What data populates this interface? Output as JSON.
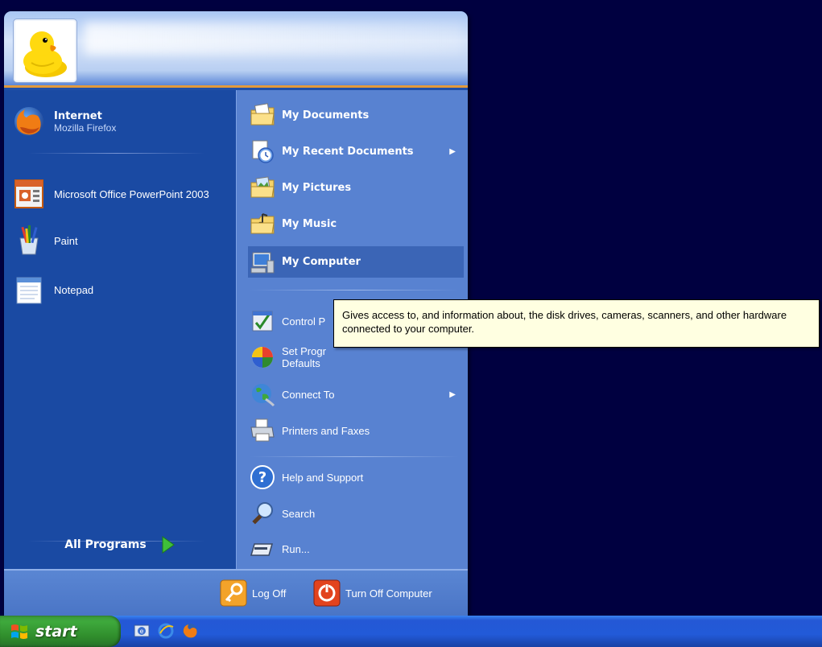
{
  "left": {
    "items": [
      {
        "label": "Internet",
        "sub": "Mozilla Firefox",
        "icon": "firefox-icon"
      },
      {
        "label": "Microsoft Office PowerPoint 2003",
        "icon": "powerpoint-icon"
      },
      {
        "label": "Paint",
        "icon": "paint-icon"
      },
      {
        "label": "Notepad",
        "icon": "notepad-icon"
      }
    ],
    "all_programs_label": "All Programs"
  },
  "right": {
    "items": [
      {
        "label": "My Documents",
        "icon": "folder-documents-icon"
      },
      {
        "label": "My Recent Documents",
        "icon": "recent-documents-icon"
      },
      {
        "label": "My Pictures",
        "icon": "folder-pictures-icon"
      },
      {
        "label": "My Music",
        "icon": "folder-music-icon"
      },
      {
        "label": "My Computer",
        "icon": "computer-icon"
      },
      {
        "label": "Control P",
        "icon": "control-panel-icon"
      },
      {
        "label": "Set Progr",
        "label2": "Defaults",
        "icon": "program-defaults-icon"
      },
      {
        "label": "Connect To",
        "icon": "connect-to-icon"
      },
      {
        "label": "Printers and Faxes",
        "icon": "printer-icon"
      },
      {
        "label": "Help and Support",
        "icon": "help-icon"
      },
      {
        "label": "Search",
        "icon": "search-icon"
      },
      {
        "label": "Run...",
        "icon": "run-icon"
      }
    ]
  },
  "footer": {
    "log_off_label": "Log Off",
    "turn_off_label": "Turn Off Computer"
  },
  "tooltip": {
    "text": "Gives access to, and information about, the disk drives, cameras, scanners, and other hardware connected to your computer."
  },
  "taskbar": {
    "start_label": "start",
    "quicklaunch": [
      "outlook-express-icon",
      "internet-explorer-icon",
      "firefox-icon"
    ]
  },
  "colors": {
    "left_bg": "#1a4aa3",
    "right_bg": "#5882d1",
    "tooltip_bg": "#ffffe1",
    "start_green": "#3ea93c",
    "desktop": "#000040"
  }
}
